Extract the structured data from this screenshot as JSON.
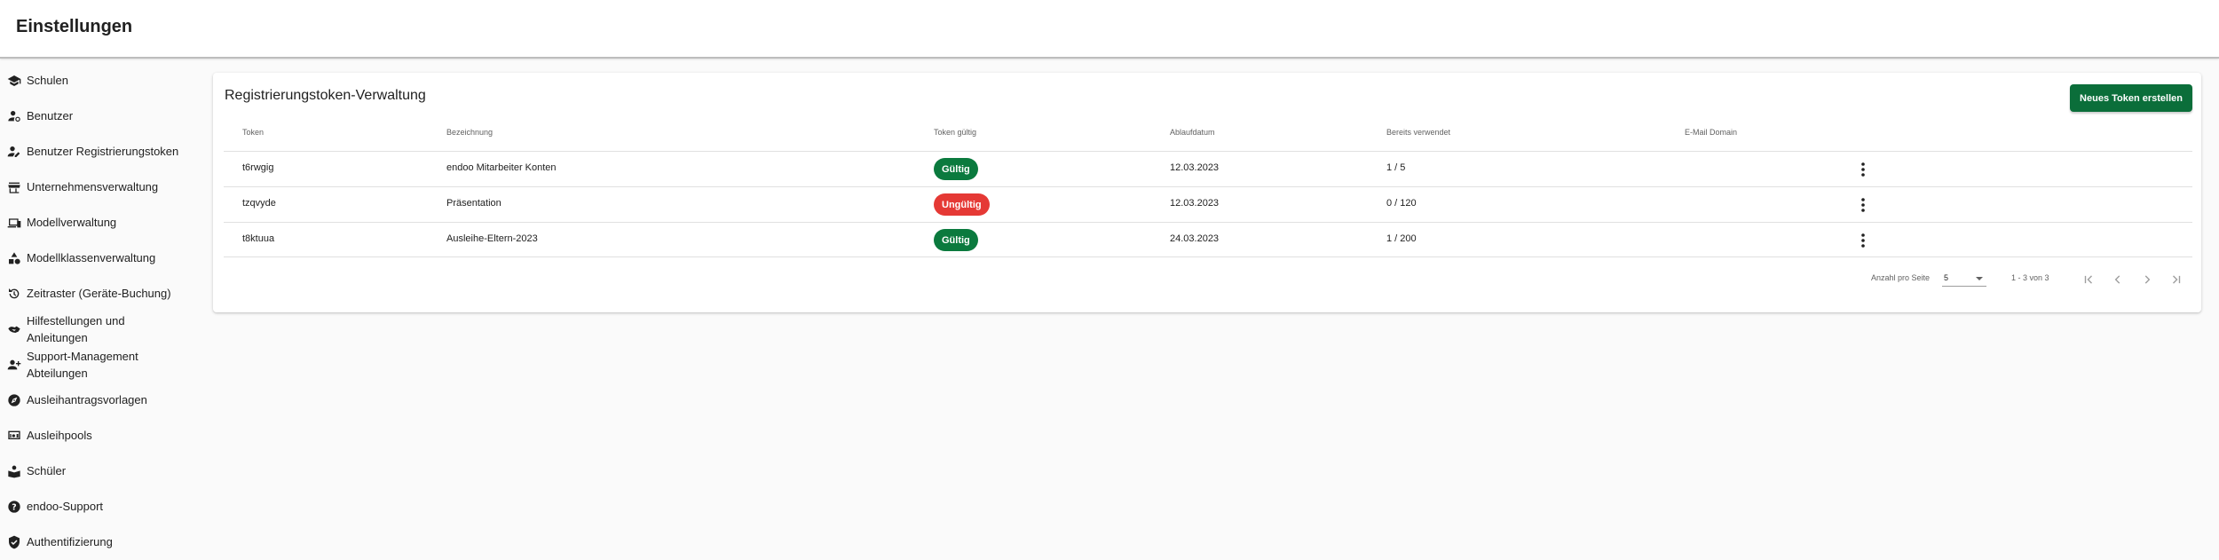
{
  "header": {
    "title": "Einstellungen"
  },
  "sidebar": {
    "items": [
      {
        "label": "Schulen",
        "icon": "school-icon"
      },
      {
        "label": "Benutzer",
        "icon": "user-settings-icon"
      },
      {
        "label": "Benutzer Registrierungstoken",
        "icon": "user-edit-icon"
      },
      {
        "label": "Unternehmensverwaltung",
        "icon": "store-icon"
      },
      {
        "label": "Modellverwaltung",
        "icon": "devices-icon"
      },
      {
        "label": "Modellklassenverwaltung",
        "icon": "shapes-icon"
      },
      {
        "label": "Zeitraster (Geräte-Buchung)",
        "icon": "history-icon"
      },
      {
        "label_line1": "Hilfestellungen und",
        "label_line2": "Anleitungen",
        "icon": "handshake-icon"
      },
      {
        "label_line1": "Support-Management",
        "label_line2": "Abteilungen",
        "icon": "group-add-icon"
      },
      {
        "label": "Ausleihantragsvorlagen",
        "icon": "explore-icon"
      },
      {
        "label": "Ausleihpools",
        "icon": "devices-other-icon"
      },
      {
        "label": "Schüler",
        "icon": "student-icon"
      },
      {
        "label": "endoo-Support",
        "icon": "help-icon"
      },
      {
        "label": "Authentifizierung",
        "icon": "verified-shield-icon"
      }
    ]
  },
  "card": {
    "title": "Registrierungstoken-Verwaltung",
    "create_button": "Neues Token erstellen"
  },
  "table": {
    "columns": [
      "Token",
      "Bezeichnung",
      "Token gültig",
      "Ablaufdatum",
      "Bereits verwendet",
      "E-Mail Domain"
    ],
    "rows": [
      {
        "token": "t6rwgig",
        "bezeichnung": "endoo Mitarbeiter Konten",
        "status": "Gültig",
        "ablaufdatum": "12.03.2023",
        "verwendet": "1 / 5",
        "domain": ""
      },
      {
        "token": "tzqvyde",
        "bezeichnung": "Präsentation",
        "status": "Ungültig",
        "ablaufdatum": "12.03.2023",
        "verwendet": "0 / 120",
        "domain": ""
      },
      {
        "token": "t8ktuua",
        "bezeichnung": "Ausleihe-Eltern-2023",
        "status": "Gültig",
        "ablaufdatum": "24.03.2023",
        "verwendet": "1 / 200",
        "domain": ""
      }
    ]
  },
  "pagination": {
    "rows_per_page_label": "Anzahl pro Seite",
    "rows_per_page_value": "5",
    "range": "1 - 3 von 3"
  },
  "colors": {
    "valid": "#0b7a3e",
    "invalid": "#e53935",
    "primary": "#0b6e3a"
  }
}
